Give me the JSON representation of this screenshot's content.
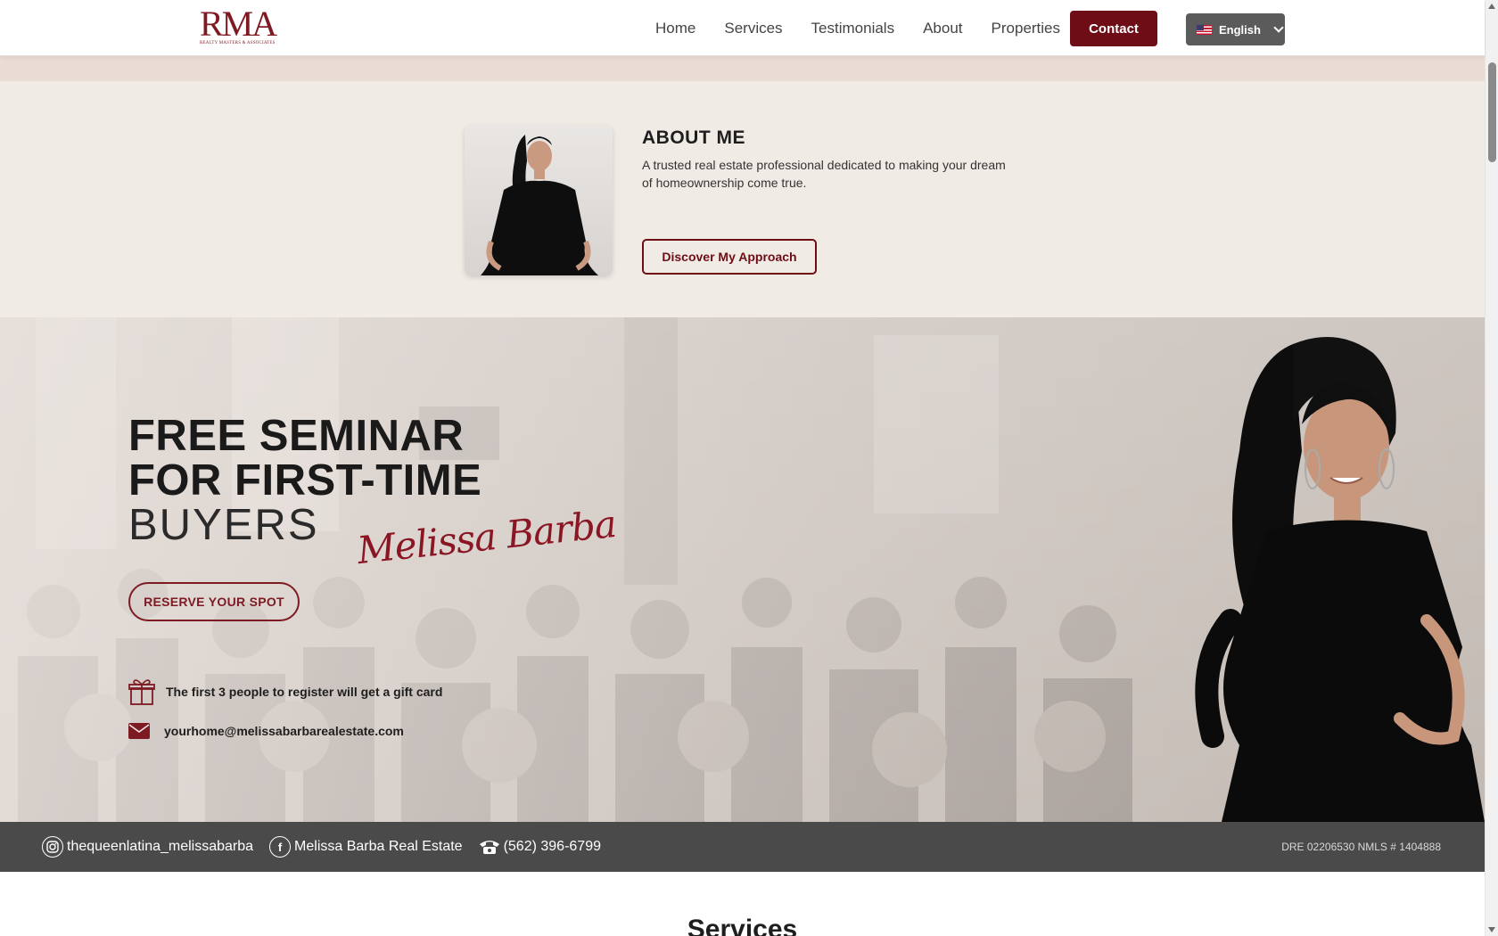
{
  "header": {
    "logo_text": "RMA",
    "logo_subtext": "REALTY MASTERS & ASSOCIATES",
    "nav": [
      "Home",
      "Services",
      "Testimonials",
      "About",
      "Properties"
    ],
    "contact_label": "Contact",
    "language": "English",
    "language_flag": "us-flag-icon"
  },
  "about": {
    "title": "ABOUT ME",
    "text": "A trusted real estate professional dedicated to making your dream of homeownership come true.",
    "button": "Discover My Approach"
  },
  "seminar": {
    "title_line1": "FREE SEMINAR",
    "title_line2": "FOR FIRST-TIME",
    "title_line3": "BUYERS",
    "signature": "Melissa Barba",
    "button": "RESERVE YOUR SPOT",
    "gift_text": "The first 3 people to register will get a gift card",
    "email": "yourhome@melissabarbarealestate.com",
    "icons": [
      "gift-icon",
      "mail-icon"
    ]
  },
  "social": {
    "instagram": "thequeenlatina_melissabarba",
    "facebook": "Melissa Barba Real Estate",
    "phone": "(562) 396-6799",
    "license": "DRE 02206530 NMLS # 1404888"
  },
  "services": {
    "title": "Services"
  },
  "colors": {
    "brand": "#6e0d16",
    "about_bg": "#f1ebe6",
    "social_bar": "#4a4a4a"
  }
}
